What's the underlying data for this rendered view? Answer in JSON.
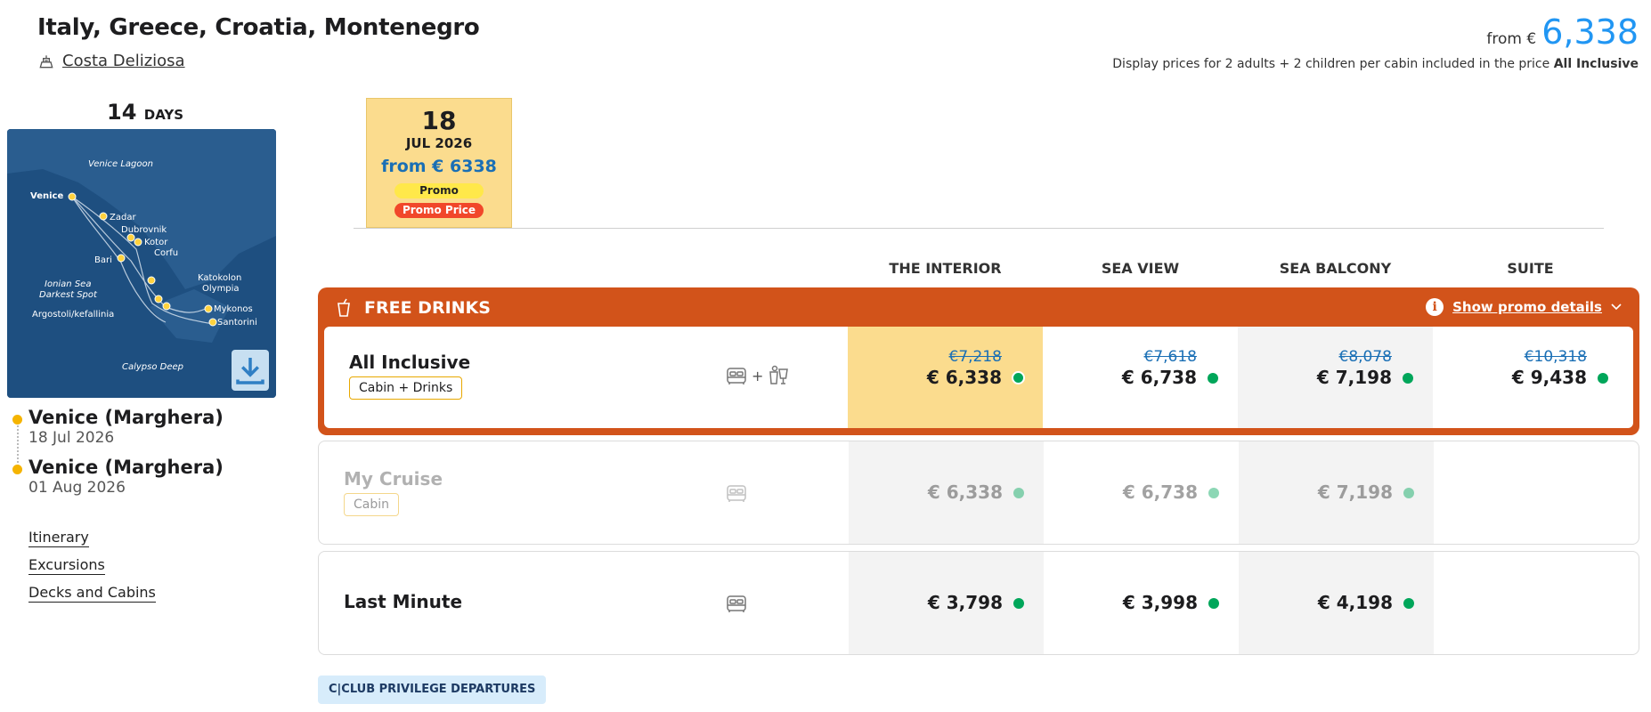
{
  "header": {
    "title": "Italy, Greece, Croatia, Montenegro",
    "ship_name": "Costa Deliziosa",
    "from_label": "from €",
    "from_price": "6,338",
    "display_note": "Display prices for 2 adults + 2 children per cabin included in the price",
    "display_note_bold": "All Inclusive"
  },
  "duration": {
    "value": "14",
    "unit": "DAYS"
  },
  "map": {
    "labels": [
      "Venice Lagoon",
      "Venice",
      "Zadar",
      "Dubrovnik",
      "Kotor",
      "Corfu",
      "Bari",
      "Katokolon",
      "Olympia",
      "Ionian Sea",
      "Darkest Spot",
      "Mykonos",
      "Santorini",
      "Argostoli/kefallinia",
      "Calypso Deep"
    ]
  },
  "itinerary": {
    "departure_port": "Venice (Marghera)",
    "departure_date": "18 Jul 2026",
    "arrival_port": "Venice (Marghera)",
    "arrival_date": "01 Aug 2026"
  },
  "links": [
    "Itinerary",
    "Excursions",
    "Decks and Cabins"
  ],
  "date_card": {
    "day": "18",
    "month_year": "JUL 2026",
    "price": "from € 6338",
    "badge_promo": "Promo",
    "badge_promo_price": "Promo Price"
  },
  "columns": [
    "THE INTERIOR",
    "SEA VIEW",
    "SEA BALCONY",
    "SUITE"
  ],
  "promo": {
    "title": "FREE DRINKS",
    "details_link": "Show promo details"
  },
  "rows": [
    {
      "name": "All Inclusive",
      "pill": "Cabin + Drinks",
      "icon_plus": "+",
      "prices": [
        {
          "old": "€7,218",
          "new": "€ 6,338"
        },
        {
          "old": "€7,618",
          "new": "€ 6,738"
        },
        {
          "old": "€8,078",
          "new": "€ 7,198"
        },
        {
          "old": "€10,318",
          "new": "€ 9,438"
        }
      ]
    },
    {
      "name": "My Cruise",
      "pill": "Cabin",
      "prices": [
        {
          "new": "€ 6,338"
        },
        {
          "new": "€ 6,738"
        },
        {
          "new": "€ 7,198"
        }
      ]
    },
    {
      "name": "Last Minute",
      "prices": [
        {
          "new": "€ 3,798"
        },
        {
          "new": "€ 3,998"
        },
        {
          "new": "€ 4,198"
        }
      ]
    }
  ],
  "club_button": "C|CLUB PRIVILEGE DEPARTURES",
  "colors": {
    "accent_blue": "#2196f3",
    "promo_orange": "#d2531a",
    "selected_yellow": "#fbdc8e",
    "available_green": "#00a65a"
  }
}
